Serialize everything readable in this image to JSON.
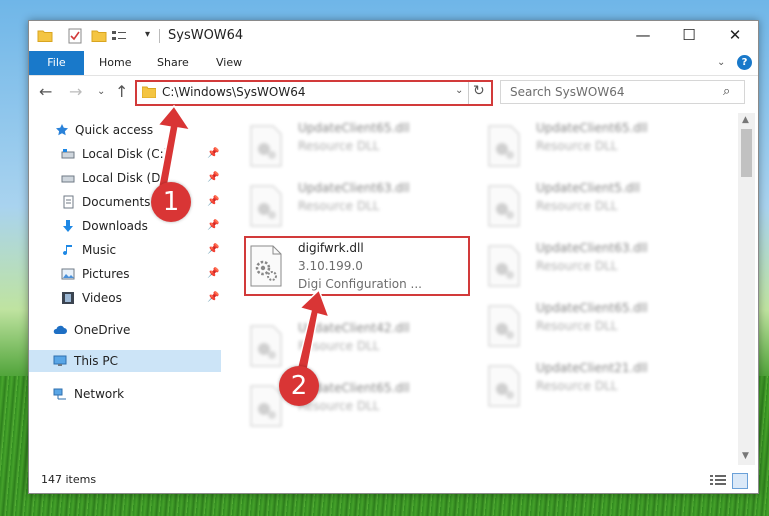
{
  "window": {
    "title": "SysWOW64",
    "controls": {
      "minimize": "—",
      "maximize": "☐",
      "close": "✕"
    }
  },
  "ribbon": {
    "tabs": [
      "File",
      "Home",
      "Share",
      "View"
    ],
    "help": "?"
  },
  "nav": {
    "address": "C:\\Windows\\SysWOW64",
    "search_placeholder": "Search SysWOW64"
  },
  "sidebar": {
    "items": [
      {
        "label": "Quick access",
        "icon": "star-icon"
      },
      {
        "label": "Local Disk (C:)",
        "icon": "drive-icon",
        "pinned": true
      },
      {
        "label": "Local Disk (D:)",
        "icon": "drive-icon",
        "pinned": true
      },
      {
        "label": "Documents",
        "icon": "documents-icon",
        "pinned": true
      },
      {
        "label": "Downloads",
        "icon": "download-arrow-icon",
        "pinned": true
      },
      {
        "label": "Music",
        "icon": "music-note-icon",
        "pinned": true
      },
      {
        "label": "Pictures",
        "icon": "pictures-icon",
        "pinned": true
      },
      {
        "label": "Videos",
        "icon": "film-icon",
        "pinned": true
      },
      {
        "label": "OneDrive",
        "icon": "cloud-icon"
      },
      {
        "label": "This PC",
        "icon": "monitor-icon",
        "selected": true
      },
      {
        "label": "Network",
        "icon": "network-icon"
      }
    ]
  },
  "files": [
    {
      "name": "UpdateClient65.dll",
      "type": "Resource DLL"
    },
    {
      "name": "UpdateClient65.dll",
      "type": "Resource DLL"
    },
    {
      "name": "UpdateClient63.dll",
      "type": "Resource DLL"
    },
    {
      "name": "UpdateClient5.dll",
      "type": "Resource DLL"
    },
    {
      "name": "digifwrk.dll",
      "version": "3.10.199.0",
      "desc": "Digi Configuration ..."
    },
    {
      "name": "UpdateClient63.dll",
      "type": "Resource DLL"
    },
    {
      "name": "UpdateClient42.dll",
      "type": "Resource DLL"
    },
    {
      "name": "UpdateClient65.dll",
      "type": "Resource DLL"
    },
    {
      "name": "UpdateClient65.dll",
      "type": "Resource DLL"
    },
    {
      "name": "UpdateClient21.dll",
      "type": "Resource DLL"
    }
  ],
  "status": {
    "item_count": "147 items"
  },
  "annotations": {
    "step1": "1",
    "step2": "2"
  },
  "colors": {
    "accent": "#1979ca",
    "highlight_red": "#d23a3a",
    "badge_red": "#d93535",
    "selected_bg": "#cce4f7"
  }
}
